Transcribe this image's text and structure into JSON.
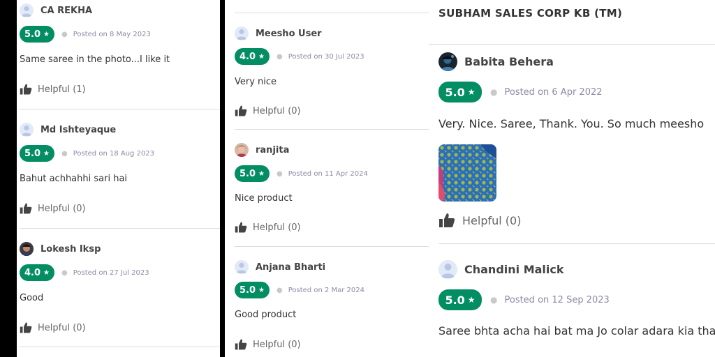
{
  "helpful_label": "Helpful",
  "colors": {
    "badge": "#038d63",
    "posted": "#8b8ba7"
  },
  "icons": {
    "star": "★",
    "helpful": "thumbs-up-icon",
    "avatar": "user-avatar-icon"
  },
  "column1": {
    "reviews": [
      {
        "name": "CA REKHA",
        "rating": "5.0",
        "posted": "Posted on 8 May 2023",
        "comment": "Same saree in the photo...I like it",
        "helpful": "Helpful (1)"
      },
      {
        "name": "Md Ishteyaque",
        "rating": "5.0",
        "posted": "Posted on 18 Aug 2023",
        "comment": "Bahut achhahhi sari hai",
        "helpful": "Helpful (0)"
      },
      {
        "name": "Lokesh Iksp",
        "rating": "4.0",
        "posted": "Posted on 27 Jul 2023",
        "comment": "Good",
        "helpful": "Helpful (0)"
      }
    ]
  },
  "column2": {
    "reviews": [
      {
        "name": "Meesho User",
        "rating": "4.0",
        "posted": "Posted on 30 Jul 2023",
        "comment": "Very nice",
        "helpful": "Helpful (0)"
      },
      {
        "name": "ranjita",
        "rating": "5.0",
        "posted": "Posted on 11 Apr 2024",
        "comment": "Nice product",
        "helpful": "Helpful (0)"
      },
      {
        "name": "Anjana Bharti",
        "rating": "5.0",
        "posted": "Posted on 2 Mar 2024",
        "comment": "Good product",
        "helpful": "Helpful (0)"
      }
    ]
  },
  "column3": {
    "seller": "SUBHAM SALES CORP KB (TM)",
    "reviews": [
      {
        "name": "Babita Behera",
        "rating": "5.0",
        "posted": "Posted on 6 Apr 2022",
        "comment": "Very. Nice. Saree, Thank. You. So much meesho",
        "helpful": "Helpful (0)"
      },
      {
        "name": "Chandini Malick",
        "rating": "5.0",
        "posted": "Posted on 12 Sep 2023",
        "comment": "Saree bhta acha hai bat ma Jo colar adara kia tha"
      }
    ]
  }
}
